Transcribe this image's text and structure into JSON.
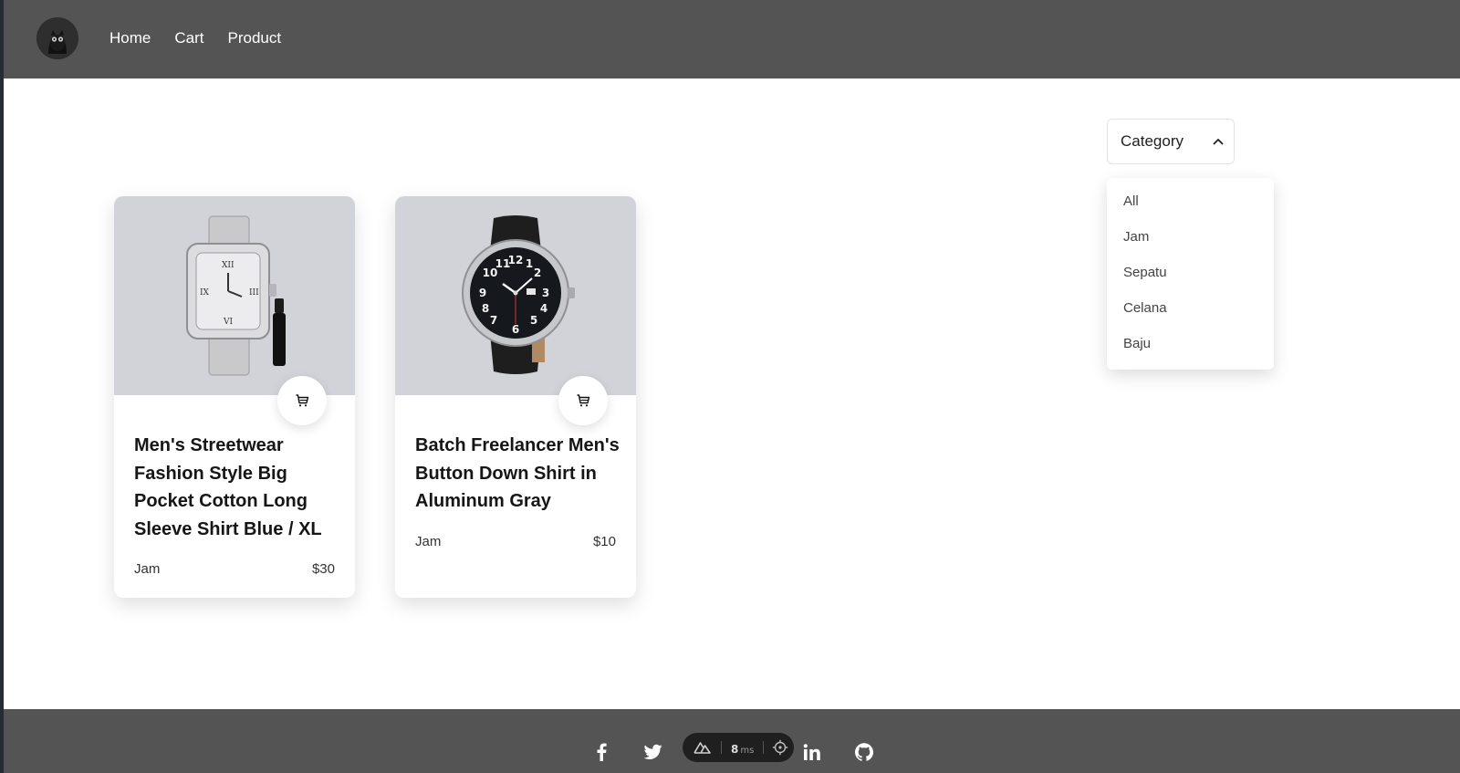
{
  "navbar": {
    "links": [
      "Home",
      "Cart",
      "Product"
    ]
  },
  "category": {
    "label": "Category",
    "options": [
      "All",
      "Jam",
      "Sepatu",
      "Celana",
      "Baju"
    ]
  },
  "products": [
    {
      "title": "Men's Streetwear Fashion Style Big Pocket Cotton Long Sleeve Shirt Blue / XL",
      "category": "Jam",
      "price": "$30",
      "image_icon": "silver-watch-image"
    },
    {
      "title": "Batch Freelancer Men's Button Down Shirt in Aluminum Gray",
      "category": "Jam",
      "price": "$10",
      "image_icon": "black-watch-image"
    }
  ],
  "footer": {
    "social_icons": [
      "facebook-icon",
      "twitter-icon",
      "linkedin-icon",
      "github-icon"
    ]
  },
  "devtools": {
    "ms_value": "8",
    "ms_unit": "ms"
  },
  "colors": {
    "navbar_bg": "#545454",
    "footer_bg": "#545454",
    "image_bg": "#d1d3d9"
  }
}
